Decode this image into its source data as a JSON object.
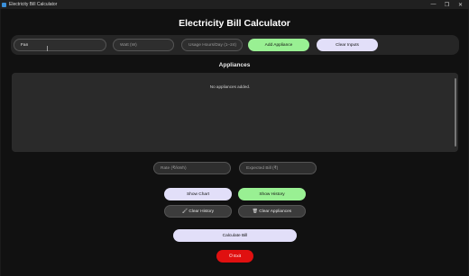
{
  "window": {
    "title": "Electricity Bill Calculator",
    "controls": [
      "—",
      "❐",
      "✕"
    ]
  },
  "header": {
    "title": "Electricity Bill Calculator"
  },
  "inputs": {
    "appliance_name": {
      "value": "Fan",
      "placeholder": ""
    },
    "watt": {
      "placeholder": "Watt (W)"
    },
    "usage": {
      "placeholder": "Usage Hours/Day (1–24)"
    }
  },
  "buttons": {
    "add_appliance": "Add Appliance",
    "clear_inputs": "Clear Inputs",
    "show_chart": "Show Chart",
    "show_history": "Show History",
    "clear_history": "🖌 Clear History",
    "clear_appliances": "🗑 Clear Appliances",
    "calculate": "Calculate Bill",
    "exit": "⏻ Exit"
  },
  "appliances": {
    "title": "Appliances",
    "empty_message": "No appliances added."
  },
  "bill": {
    "rate_placeholder": "Rate (₹/kWh)",
    "expected_placeholder": "Expected Bill (₹)"
  },
  "colors": {
    "accent_green": "#99f093",
    "accent_lavender": "#e2dff9",
    "exit_red": "#e01010"
  }
}
